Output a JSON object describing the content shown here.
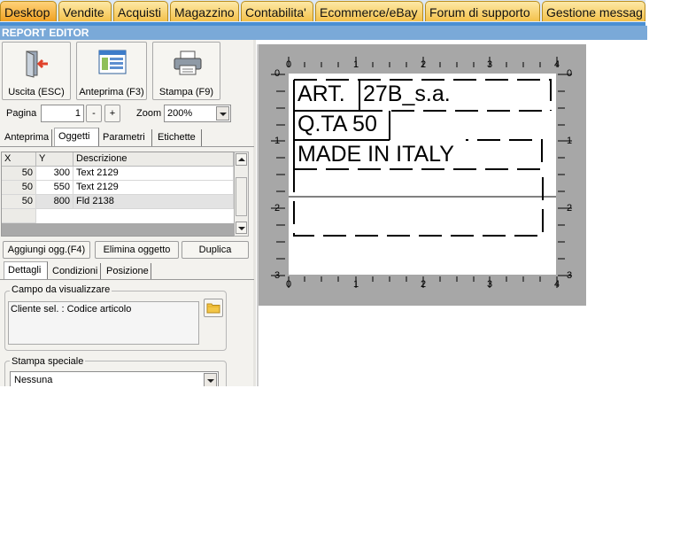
{
  "tabs": [
    {
      "label": "Desktop",
      "active": true
    },
    {
      "label": "Vendite"
    },
    {
      "label": "Acquisti"
    },
    {
      "label": "Magazzino"
    },
    {
      "label": "Contabilita'"
    },
    {
      "label": "Ecommerce/eBay"
    },
    {
      "label": "Forum di supporto"
    },
    {
      "label": "Gestione messag"
    }
  ],
  "window": {
    "title": "REPORT EDITOR"
  },
  "toolbar": {
    "exit_label": "Uscita (ESC)",
    "preview_label": "Anteprima (F3)",
    "print_label": "Stampa (F9)"
  },
  "paging": {
    "page_label": "Pagina",
    "page_value": "1",
    "minus_label": "-",
    "plus_label": "+",
    "zoom_label": "Zoom",
    "zoom_value": "200%"
  },
  "section_tabs": [
    "Anteprima",
    "Oggetti",
    "Parametri",
    "Etichette"
  ],
  "objects_table": {
    "columns": [
      "X",
      "Y",
      "Descrizione"
    ],
    "rows": [
      {
        "x": "50",
        "y": "300",
        "desc": "Text 2129"
      },
      {
        "x": "50",
        "y": "550",
        "desc": "Text 2129"
      },
      {
        "x": "50",
        "y": "800",
        "desc": "Fld 2138"
      }
    ]
  },
  "object_buttons": {
    "add": "Aggiungi ogg.(F4)",
    "delete": "Elimina oggetto",
    "duplicate": "Duplica"
  },
  "detail_tabs": [
    "Dettagli",
    "Condizioni",
    "Posizione"
  ],
  "field_group": {
    "title": "Campo da visualizzare",
    "value": "Cliente sel. : Codice articolo"
  },
  "special_print": {
    "title": "Stampa speciale",
    "value": "Nessuna"
  },
  "ruler": {
    "ticks": [
      "0",
      "1",
      "2",
      "3",
      "4"
    ],
    "v_ticks": [
      "0",
      "1",
      "2",
      "3"
    ]
  },
  "label_preview": {
    "line1_a": "ART.",
    "line1_b": "27B_s.a.",
    "line2": "Q.TA 50",
    "line3": "MADE IN ITALY"
  },
  "colors": {
    "tab_active": "#f0a122",
    "title_bar": "#7aa9d8",
    "accent": "#4a8fd3"
  },
  "icons": {
    "exit": "exit-door-icon",
    "preview": "preview-window-icon",
    "print": "printer-icon",
    "folder": "folder-icon"
  }
}
